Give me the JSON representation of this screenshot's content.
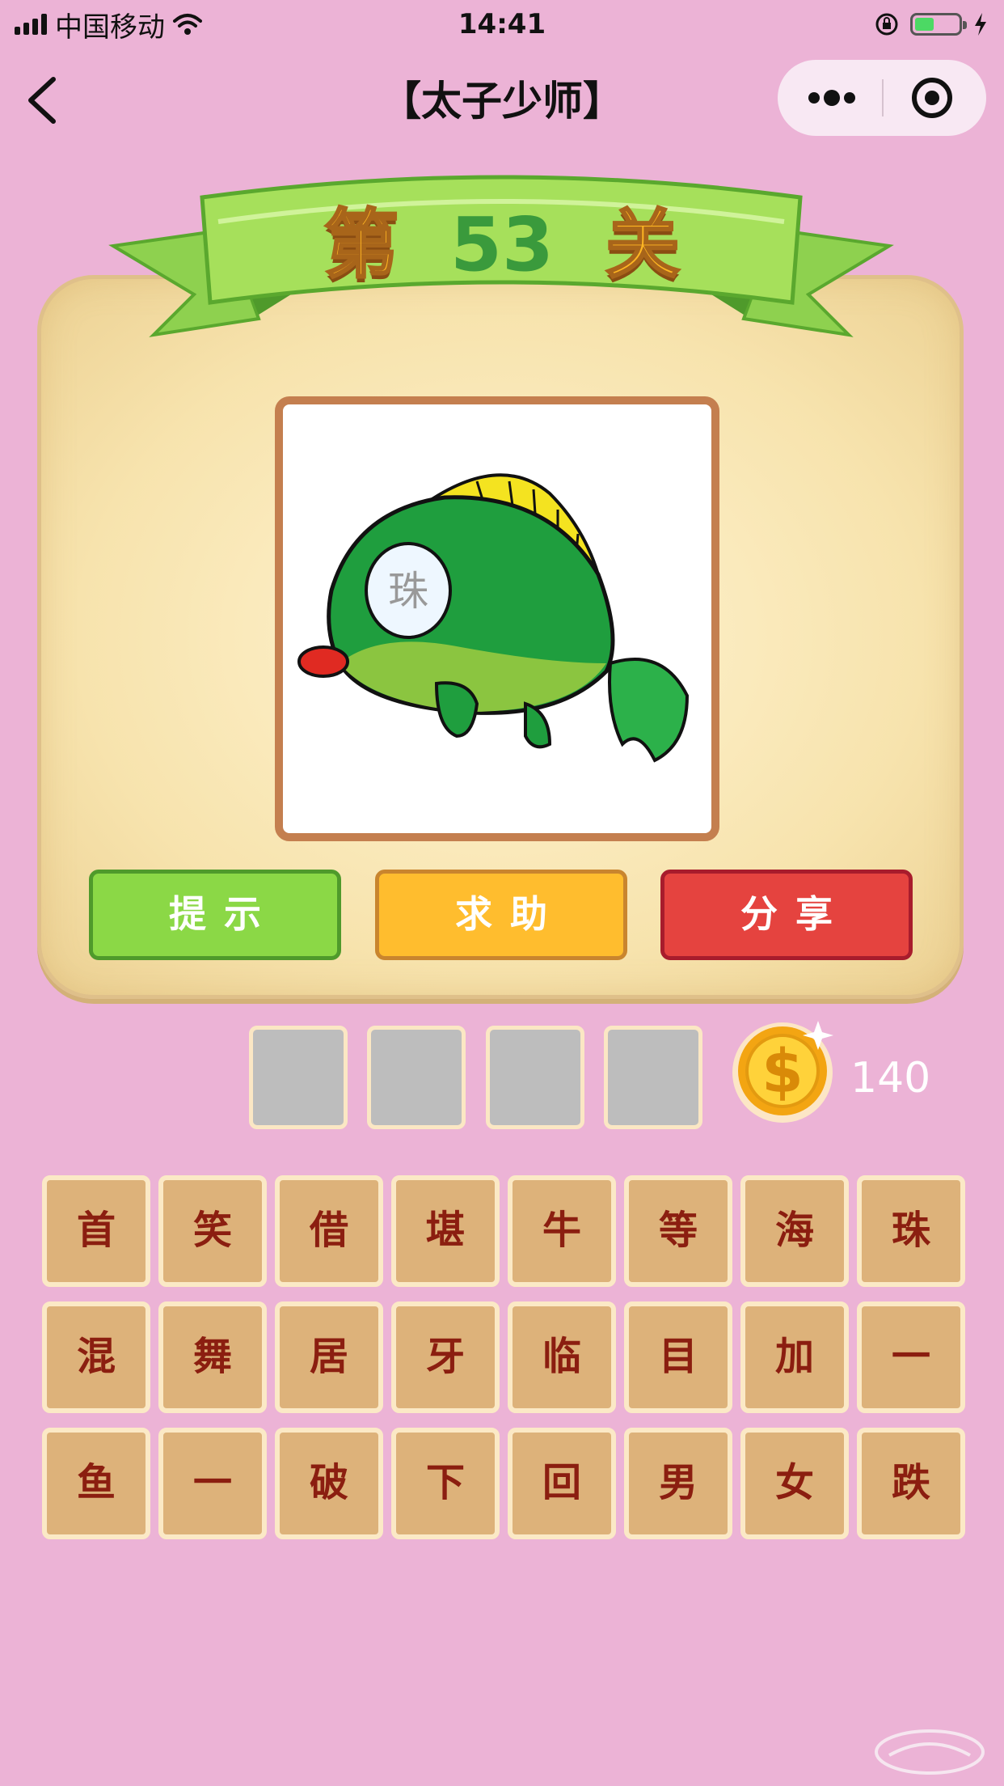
{
  "status_bar": {
    "carrier": "中国移动",
    "time": "14:41",
    "battery_level": 0.45
  },
  "nav": {
    "title": "【太子少师】"
  },
  "level": {
    "prefix": "第",
    "number": "53",
    "suffix": "关"
  },
  "picture": {
    "stone_label": "珠"
  },
  "actions": {
    "hint_label": "提示",
    "help_label": "求助",
    "share_label": "分享"
  },
  "answer_slots": [
    "",
    "",
    "",
    ""
  ],
  "coins": "140",
  "tiles": [
    "首",
    "笑",
    "借",
    "堪",
    "牛",
    "等",
    "海",
    "珠",
    "混",
    "舞",
    "居",
    "牙",
    "临",
    "目",
    "加",
    "一",
    "鱼",
    "一",
    "破",
    "下",
    "回",
    "男",
    "女",
    "跌"
  ],
  "colors": {
    "background": "#ecb3d6",
    "hint": "#8bd846",
    "help": "#ffbd2e",
    "share": "#e5433f",
    "tile": "#ddb27a",
    "tile_text": "#8b1e10"
  },
  "icons": {
    "back": "chevron-left-icon",
    "more": "more-dots-icon",
    "close_app": "target-icon",
    "coin": "coin-icon"
  }
}
